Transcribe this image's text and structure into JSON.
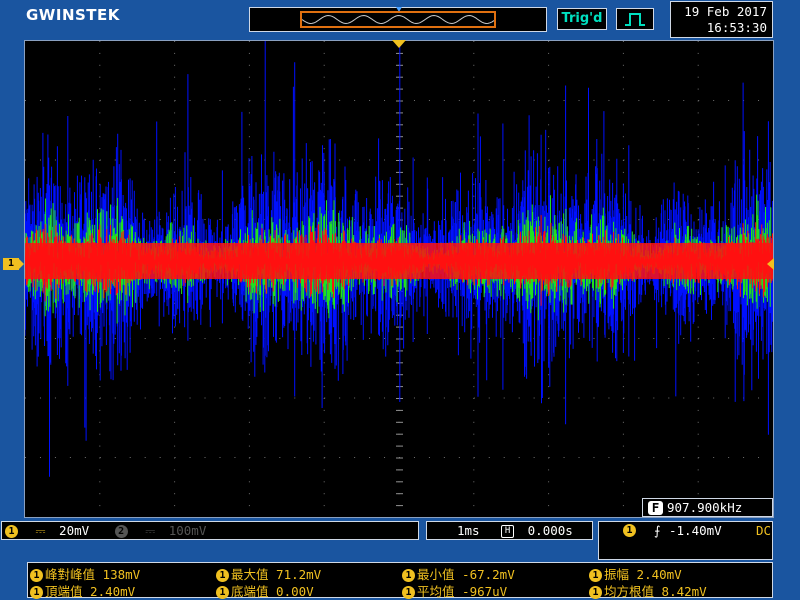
{
  "brand": "GWINSTEK",
  "status": {
    "trigger": "Trig'd"
  },
  "datetime": {
    "date": "19 Feb 2017",
    "time": "16:53:30"
  },
  "markers": {
    "ch1": "1"
  },
  "frequency": {
    "label": "F",
    "value": "907.900kHz"
  },
  "channels": {
    "ch1": {
      "number": "1",
      "coupling": "⎓",
      "scale": "20mV"
    },
    "ch2": {
      "number": "2",
      "coupling": "⎓",
      "scale": "100mV"
    }
  },
  "timebase": {
    "scale": "1ms",
    "icon": "H",
    "position": "0.000s"
  },
  "trigger": {
    "source": "1",
    "slope": "⨍",
    "level": "-1.40mV",
    "coupling": "DC"
  },
  "measurements": [
    {
      "label": "峰對峰值",
      "value": "138mV"
    },
    {
      "label": "最大值",
      "value": "71.2mV"
    },
    {
      "label": "最小值",
      "value": "-67.2mV"
    },
    {
      "label": "振幅",
      "value": "2.40mV"
    },
    {
      "label": "頂端值",
      "value": "2.40mV"
    },
    {
      "label": "底端值",
      "value": "0.00V"
    },
    {
      "label": "平均值",
      "value": "-967uV"
    },
    {
      "label": "均方根值",
      "value": "8.42mV"
    }
  ],
  "colors": {
    "ch1_trace_outer": "#0010ff",
    "ch1_trace_mid": "#20e020",
    "ch1_trace_core": "#ff1010",
    "marker": "#f0c020"
  }
}
